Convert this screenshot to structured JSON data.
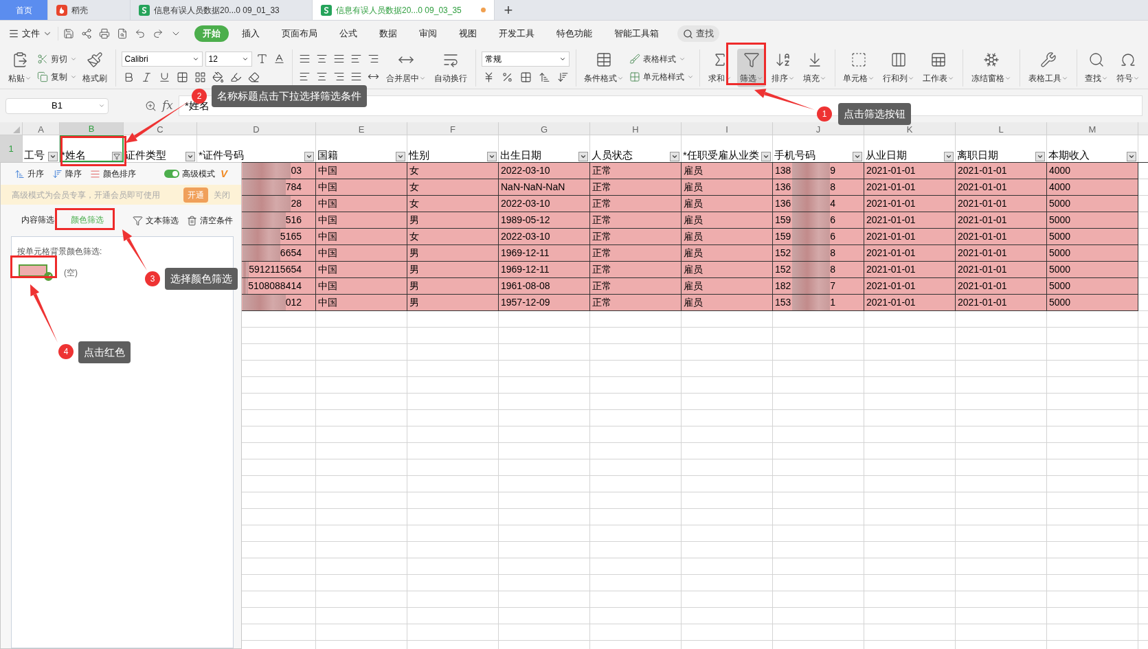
{
  "tabs": [
    {
      "label": "首页",
      "kind": "home",
      "selected": false,
      "unsaved": false
    },
    {
      "label": "稻壳",
      "kind": "docer",
      "selected": false,
      "unsaved": false
    },
    {
      "label": "信息有误人员数据20...0 09_01_33",
      "kind": "sheet",
      "selected": false,
      "unsaved": false
    },
    {
      "label": "信息有误人员数据20...0 09_03_35",
      "kind": "sheet",
      "selected": true,
      "unsaved": true
    }
  ],
  "new_tab": "+",
  "menu": {
    "file": "文件",
    "tabs": [
      {
        "label": "开始",
        "selected": true
      },
      {
        "label": "插入",
        "selected": false
      },
      {
        "label": "页面布局",
        "selected": false
      },
      {
        "label": "公式",
        "selected": false
      },
      {
        "label": "数据",
        "selected": false
      },
      {
        "label": "审阅",
        "selected": false
      },
      {
        "label": "视图",
        "selected": false
      },
      {
        "label": "开发工具",
        "selected": false
      },
      {
        "label": "特色功能",
        "selected": false
      },
      {
        "label": "智能工具箱",
        "selected": false
      }
    ],
    "search": "查找"
  },
  "ribbon": {
    "paste": "粘贴",
    "cut": "剪切",
    "copy": "复制",
    "format_painter": "格式刷",
    "font_name": "Calibri",
    "font_size": "12",
    "merge": "合并居中",
    "wrap": "自动换行",
    "number_format": "常规",
    "conditional_format": "条件格式",
    "table_style": "表格样式",
    "cell_style": "单元格样式",
    "tool_groups": [
      [
        {
          "label": "求和",
          "active": false
        },
        {
          "label": "筛选",
          "active": true
        },
        {
          "label": "排序",
          "active": false
        },
        {
          "label": "填充",
          "active": false
        }
      ],
      [
        {
          "label": "单元格",
          "active": false
        },
        {
          "label": "行和列",
          "active": false
        },
        {
          "label": "工作表",
          "active": false
        }
      ],
      [
        {
          "label": "冻结窗格",
          "active": false
        }
      ],
      [
        {
          "label": "表格工具",
          "active": false
        }
      ],
      [
        {
          "label": "查找",
          "active": false
        },
        {
          "label": "符号",
          "active": false
        }
      ]
    ]
  },
  "formula_bar": {
    "cell_ref": "B1",
    "fx": "fx",
    "value": "*姓名"
  },
  "sheet": {
    "columns": [
      {
        "letter": "A",
        "header": "工号",
        "selected": false,
        "filter_applied": false
      },
      {
        "letter": "B",
        "header": "*姓名",
        "selected": true,
        "filter_applied": true
      },
      {
        "letter": "C",
        "header": "证件类型",
        "selected": false,
        "filter_applied": false
      },
      {
        "letter": "D",
        "header": "*证件号码",
        "selected": false,
        "filter_applied": false
      },
      {
        "letter": "E",
        "header": "国籍",
        "selected": false,
        "filter_applied": false
      },
      {
        "letter": "F",
        "header": "性别",
        "selected": false,
        "filter_applied": false
      },
      {
        "letter": "G",
        "header": "出生日期",
        "selected": false,
        "filter_applied": false
      },
      {
        "letter": "H",
        "header": "人员状态",
        "selected": false,
        "filter_applied": false
      },
      {
        "letter": "I",
        "header": "*任职受雇从业类",
        "selected": false,
        "filter_applied": false
      },
      {
        "letter": "J",
        "header": "手机号码",
        "selected": false,
        "filter_applied": false
      },
      {
        "letter": "K",
        "header": "从业日期",
        "selected": false,
        "filter_applied": false
      },
      {
        "letter": "L",
        "header": "离职日期",
        "selected": false,
        "filter_applied": false
      },
      {
        "letter": "M",
        "header": "本期收入",
        "selected": false,
        "filter_applied": false
      }
    ],
    "header_row": {
      "label": "1",
      "selected": true
    },
    "rows": [
      {
        "id_tail": "03",
        "nationality": "中国",
        "gender": "女",
        "birth": "2022-03-10",
        "status": "正常",
        "type": "雇员",
        "phone_head": "138",
        "phone_tail": "9",
        "start": "2021-01-01",
        "end": "2021-01-01",
        "income": "4000"
      },
      {
        "id_tail": "784",
        "nationality": "中国",
        "gender": "女",
        "birth": "NaN-NaN-NaN",
        "status": "正常",
        "type": "雇员",
        "phone_head": "136",
        "phone_tail": "8",
        "start": "2021-01-01",
        "end": "2021-01-01",
        "income": "4000"
      },
      {
        "id_tail": "28",
        "nationality": "中国",
        "gender": "女",
        "birth": "2022-03-10",
        "status": "正常",
        "type": "雇员",
        "phone_head": "136",
        "phone_tail": "4",
        "start": "2021-01-01",
        "end": "2021-01-01",
        "income": "5000"
      },
      {
        "id_tail": "516",
        "nationality": "中国",
        "gender": "男",
        "birth": "1989-05-12",
        "status": "正常",
        "type": "雇员",
        "phone_head": "159",
        "phone_tail": "6",
        "start": "2021-01-01",
        "end": "2021-01-01",
        "income": "5000"
      },
      {
        "id_tail": "5165",
        "nationality": "中国",
        "gender": "女",
        "birth": "2022-03-10",
        "status": "正常",
        "type": "雇员",
        "phone_head": "159",
        "phone_tail": "6",
        "start": "2021-01-01",
        "end": "2021-01-01",
        "income": "5000"
      },
      {
        "id_tail": "6654",
        "nationality": "中国",
        "gender": "男",
        "birth": "1969-12-11",
        "status": "正常",
        "type": "雇员",
        "phone_head": "152",
        "phone_tail": "8",
        "start": "2021-01-01",
        "end": "2021-01-01",
        "income": "5000"
      },
      {
        "id_tail": "5912115654",
        "nationality": "中国",
        "gender": "男",
        "birth": "1969-12-11",
        "status": "正常",
        "type": "雇员",
        "phone_head": "152",
        "phone_tail": "8",
        "start": "2021-01-01",
        "end": "2021-01-01",
        "income": "5000"
      },
      {
        "id_tail": "5108088414",
        "nationality": "中国",
        "gender": "男",
        "birth": "1961-08-08",
        "status": "正常",
        "type": "雇员",
        "phone_head": "182",
        "phone_tail": "7",
        "start": "2021-01-01",
        "end": "2021-01-01",
        "income": "5000"
      },
      {
        "id_tail": "012",
        "nationality": "中国",
        "gender": "男",
        "birth": "1957-12-09",
        "status": "正常",
        "type": "雇员",
        "phone_head": "153",
        "phone_tail": "1",
        "start": "2021-01-01",
        "end": "2021-01-01",
        "income": "5000"
      }
    ]
  },
  "filter_panel": {
    "sort": [
      "升序",
      "降序",
      "颜色排序"
    ],
    "advanced_mode": {
      "label": "高级模式",
      "on": true,
      "badge": "V"
    },
    "banner": {
      "text": "高级模式为会员专享，开通会员即可使用",
      "open": "开通",
      "close": "关闭"
    },
    "tabs": [
      {
        "label": "内容筛选",
        "selected": false
      },
      {
        "label": "颜色筛选",
        "selected": true
      }
    ],
    "text_filter": "文本筛选",
    "clear": "清空条件",
    "color_filter": {
      "heading": "按单元格背景颜色筛选:",
      "swatches": [
        {
          "color": "#eeadad",
          "checked": true
        }
      ],
      "empty_label": "(空)"
    }
  },
  "annotations": [
    {
      "number": "1",
      "text": "点击筛选按钮"
    },
    {
      "number": "2",
      "text": "名称标题点击下拉选择筛选条件"
    },
    {
      "number": "3",
      "text": "选择颜色筛选"
    },
    {
      "number": "4",
      "text": "点击红色"
    }
  ]
}
